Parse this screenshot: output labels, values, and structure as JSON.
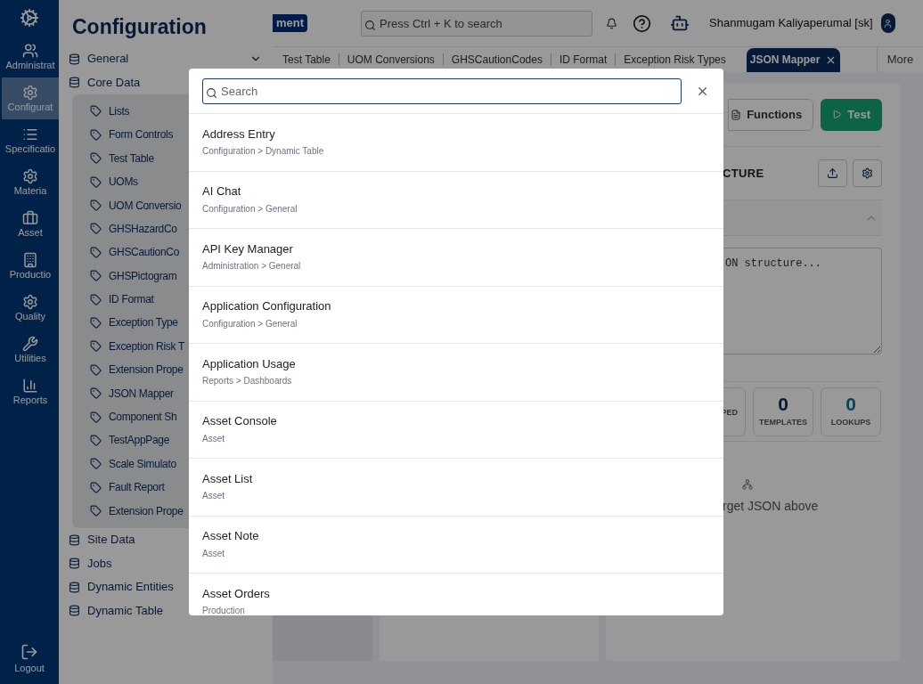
{
  "rail": {
    "items": [
      {
        "label": "Administrat",
        "selected": false
      },
      {
        "label": "Configurat",
        "selected": true
      },
      {
        "label": "Specificatio",
        "selected": false
      },
      {
        "label": "Materia",
        "selected": false
      },
      {
        "label": "Asset",
        "selected": false
      },
      {
        "label": "Productio",
        "selected": false
      },
      {
        "label": "Quality",
        "selected": false
      },
      {
        "label": "Utilities",
        "selected": false
      },
      {
        "label": "Reports",
        "selected": false
      }
    ],
    "logout": "Logout"
  },
  "config": {
    "title": "Configuration",
    "sections": [
      {
        "label": "General",
        "expanded": false
      },
      {
        "label": "Core Data",
        "expanded": true,
        "children": [
          "Lists",
          "Form Controls",
          "Test Table",
          "UOMs",
          "UOM Conversio",
          "GHSHazardCo",
          "GHSCautionCo",
          "GHSPictogram",
          "ID Format",
          "Exception Type",
          "Exception Risk T",
          "Extension Prope",
          "JSON Mapper",
          "Component Sh",
          "TestAppPage",
          "Scale Simulato",
          "Fault Report",
          "Extension Prope"
        ]
      },
      {
        "label": "Site Data"
      },
      {
        "label": "Jobs"
      },
      {
        "label": "Dynamic Entities"
      },
      {
        "label": "Dynamic Table"
      }
    ]
  },
  "header": {
    "badge": "ment",
    "search": {
      "placeholder": "Press Ctrl + K to search"
    },
    "user": "Shanmugam Kaliyaperumal [sk]"
  },
  "tabs": [
    {
      "label": "Test Table",
      "selected": false
    },
    {
      "label": "UOM Conversions",
      "selected": false
    },
    {
      "label": "GHSCautionCodes",
      "selected": false
    },
    {
      "label": "ID Format",
      "selected": false
    },
    {
      "label": "Exception Risk Types",
      "selected": false
    },
    {
      "label": "JSON Mapper",
      "selected": true
    }
  ],
  "more": "More",
  "content": {
    "functions": "Functions",
    "test": "Test",
    "section_title": "CTURE",
    "textarea_placeholder": "ON structure...",
    "stats": [
      {
        "label": "PED"
      },
      {
        "value": "0",
        "label": "TEMPLATES"
      },
      {
        "value": "0",
        "label": "LOOKUPS"
      }
    ],
    "empty_text": "rget JSON above"
  },
  "modal": {
    "search": {
      "placeholder": "Search"
    },
    "results": [
      {
        "title": "Address Entry",
        "path": "Configuration > Dynamic Table"
      },
      {
        "title": "AI Chat",
        "path": "Configuration > General"
      },
      {
        "title": "API Key Manager",
        "path": "Administration > General"
      },
      {
        "title": "Application Configuration",
        "path": "Configuration > General"
      },
      {
        "title": "Application Usage",
        "path": "Reports > Dashboards"
      },
      {
        "title": "Asset Console",
        "path": "Asset"
      },
      {
        "title": "Asset List",
        "path": "Asset"
      },
      {
        "title": "Asset Note",
        "path": "Asset"
      },
      {
        "title": "Asset Orders",
        "path": "Production"
      }
    ]
  }
}
